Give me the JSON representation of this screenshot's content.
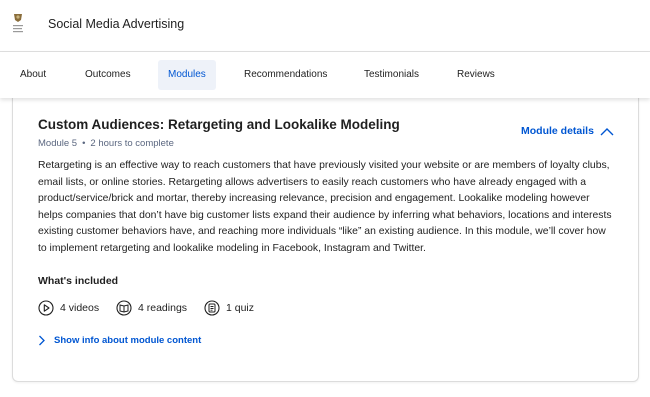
{
  "header": {
    "course_title": "Social Media Advertising"
  },
  "nav": {
    "tabs": [
      {
        "label": "About"
      },
      {
        "label": "Outcomes"
      },
      {
        "label": "Modules"
      },
      {
        "label": "Recommendations"
      },
      {
        "label": "Testimonials"
      },
      {
        "label": "Reviews"
      }
    ],
    "active_tab": "Modules"
  },
  "module": {
    "title": "Custom Audiences: Retargeting and Lookalike Modeling",
    "number": "Module 5",
    "separator": "•",
    "duration": "2 hours to complete",
    "details_label": "Module details",
    "description": "Retargeting is an effective way to reach customers that have previously visited your website or are members of loyalty clubs, email lists, or online stories. Retargeting allows advertisers to easily reach customers who have already engaged with a product/service/brick and mortar, thereby increasing relevance, precision and engagement. Lookalike modeling however helps companies that don’t have big customer lists expand their audience by inferring what behaviors, locations and interests existing customer behaviors have, and reaching more individuals “like” an existing audience. In this module, we’ll cover how to implement retargeting and lookalike modeling in Facebook, Instagram and Twitter.",
    "included_heading": "What's included",
    "included": [
      {
        "icon": "play-circle-icon",
        "label": "4 videos"
      },
      {
        "icon": "book-icon",
        "label": "4 readings"
      },
      {
        "icon": "quiz-icon",
        "label": "1 quiz"
      }
    ],
    "show_info_label": "Show info about module content"
  },
  "colors": {
    "accent": "#0056d2",
    "active_tab_bg": "#eef2f9",
    "meta_text": "#5b6780"
  }
}
